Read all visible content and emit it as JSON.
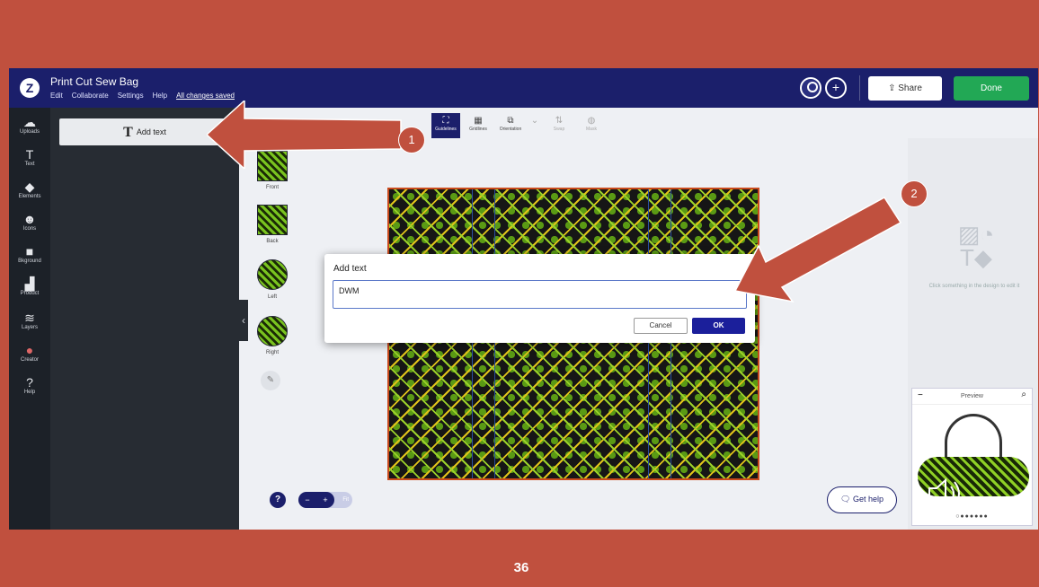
{
  "app": {
    "doc_title": "Print Cut Sew Bag",
    "menu": [
      "Edit",
      "Collaborate",
      "Settings",
      "Help"
    ],
    "saved_status": "All changes saved",
    "share_label": "Share",
    "done_label": "Done"
  },
  "rail": [
    {
      "label": "Uploads",
      "icon": "cloud-icon"
    },
    {
      "label": "Text",
      "icon": "text-icon"
    },
    {
      "label": "Elements",
      "icon": "shapes-icon"
    },
    {
      "label": "Icons",
      "icon": "smiley-icon"
    },
    {
      "label": "Bkground",
      "icon": "background-icon"
    },
    {
      "label": "Product",
      "icon": "product-icon"
    },
    {
      "label": "Layers",
      "icon": "layers-icon"
    },
    {
      "label": "Creator",
      "icon": "avatar-icon"
    },
    {
      "label": "Help",
      "icon": "help-icon"
    }
  ],
  "panel": {
    "add_text_label": "Add text"
  },
  "toolbar": [
    {
      "label": "Guidelines",
      "active": true
    },
    {
      "label": "Gridlines",
      "active": false
    },
    {
      "label": "Orientation",
      "active": false
    },
    {
      "label": "Swap",
      "active": false,
      "disabled": true
    },
    {
      "label": "Mask",
      "active": false,
      "disabled": true
    }
  ],
  "views": [
    "Front",
    "Back",
    "Left",
    "Right"
  ],
  "right_panel": {
    "hint": "Click something in the design to edit it"
  },
  "preview": {
    "title": "Preview",
    "dots": "○●●●●●●"
  },
  "zoom": {
    "fit_label": "Fit"
  },
  "get_help_label": "Get help",
  "dialog": {
    "title": "Add text",
    "input_value": "DWM",
    "cancel_label": "Cancel",
    "ok_label": "OK"
  },
  "callouts": [
    "1",
    "2"
  ],
  "slide_number": "36",
  "colors": {
    "slide_bg": "#c0503e",
    "topbar": "#1b1f6b",
    "done": "#22a855",
    "ok": "#1b1f9b"
  }
}
